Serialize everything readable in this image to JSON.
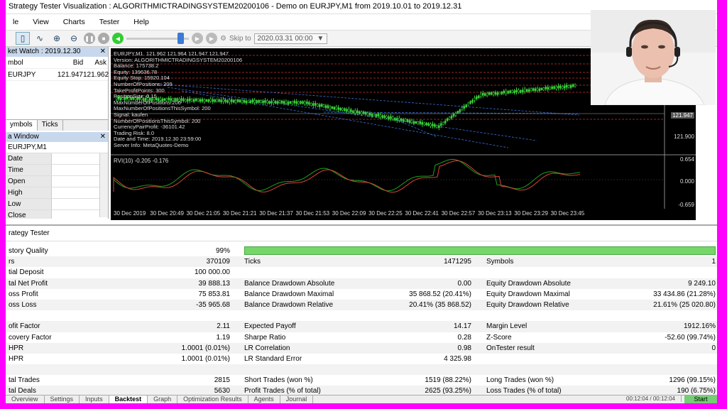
{
  "window": {
    "title": "Strategy Tester Visualization : ALGORITHMICTRADINGSYSTEM20200106 - Demo on EURJPY,M1 from 2019.10.01 to 2019.12.31"
  },
  "menu": [
    "le",
    "View",
    "Charts",
    "Tester",
    "Help"
  ],
  "toolbar": {
    "skip_label": "Skip to",
    "skip_date": "2020.03.31 00:00"
  },
  "market_watch": {
    "title": "ket Watch : 2019.12.30",
    "headers": [
      "mbol",
      "Bid",
      "Ask"
    ],
    "rows": [
      {
        "symbol": "EURJPY",
        "bid": "121.947",
        "ask": "121.962"
      }
    ],
    "tabs": [
      "ymbols",
      "Ticks"
    ]
  },
  "data_window": {
    "title": "a Window",
    "symbol": "EURJPY,M1",
    "rows": [
      "Date",
      "Time",
      "Open",
      "High",
      "Low",
      "Close"
    ]
  },
  "chart": {
    "info_lines": [
      "EURJPY,M1  121.962 121.964 121.947 121.947",
      "Version: ALGORITHMICTRADINGSYSTEM20200106",
      "Balance: 175738.2",
      "Equity: 139636.78",
      "Equity Stop: 15920.104",
      "NumberOfPositions: 209",
      "TakeProfitPoints: 300",
      "PositionSize: 0.15",
      "MaxNumberOfPositions:200",
      "MaxNumberOfPositionsThisSymbol: 200",
      "Signal: kaufen",
      "NumberOfPositionsThisSymbol: 200",
      "CurrencyPairProfit: -36101.42",
      "Trading Risk: 8.0",
      "Date and Time: 2019.12.30 23:59:00",
      "Server Info: MetaQuotes-Demo"
    ],
    "price_axis": [
      "121.947",
      "121.900"
    ],
    "rvi_label": "RVI(10) -0.205 -0.176",
    "rvi_axis": [
      "0.654",
      "0.000",
      "-0.659"
    ],
    "x_labels": [
      "30 Dec 2019",
      "30 Dec 20:49",
      "30 Dec 21:05",
      "30 Dec 21:21",
      "30 Dec 21:37",
      "30 Dec 21:53",
      "30 Dec 22:09",
      "30 Dec 22:25",
      "30 Dec 22:41",
      "30 Dec 22:57",
      "30 Dec 23:13",
      "30 Dec 23:29",
      "30 Dec 23:45"
    ]
  },
  "tester": {
    "title": "rategy Tester",
    "rows": [
      {
        "a": [
          "story Quality",
          "99%"
        ],
        "b": [
          "",
          ""
        ],
        "c": [
          "",
          ""
        ],
        "bar": true
      },
      {
        "a": [
          "rs",
          "370109"
        ],
        "b": [
          "Ticks",
          "1471295"
        ],
        "c": [
          "Symbols",
          "1"
        ]
      },
      {
        "a": [
          "tial Deposit",
          "100 000.00"
        ],
        "b": [
          "",
          ""
        ],
        "c": [
          "",
          ""
        ]
      },
      {
        "a": [
          "tal Net Profit",
          "39 888.13"
        ],
        "b": [
          "Balance Drawdown Absolute",
          "0.00"
        ],
        "c": [
          "Equity Drawdown Absolute",
          "9 249.10"
        ]
      },
      {
        "a": [
          "oss Profit",
          "75 853.81"
        ],
        "b": [
          "Balance Drawdown Maximal",
          "35 868.52 (20.41%)"
        ],
        "c": [
          "Equity Drawdown Maximal",
          "33 434.86 (21.28%)"
        ]
      },
      {
        "a": [
          "oss Loss",
          "-35 965.68"
        ],
        "b": [
          "Balance Drawdown Relative",
          "20.41% (35 868.52)"
        ],
        "c": [
          "Equity Drawdown Relative",
          "21.61% (25 020.80)"
        ]
      },
      {
        "a": [
          "",
          ""
        ],
        "b": [
          "",
          ""
        ],
        "c": [
          "",
          ""
        ]
      },
      {
        "a": [
          "ofit Factor",
          "2.11"
        ],
        "b": [
          "Expected Payoff",
          "14.17"
        ],
        "c": [
          "Margin Level",
          "1912.16%"
        ]
      },
      {
        "a": [
          "covery Factor",
          "1.19"
        ],
        "b": [
          "Sharpe Ratio",
          "0.28"
        ],
        "c": [
          "Z-Score",
          "-52.60 (99.74%)"
        ]
      },
      {
        "a": [
          "HPR",
          "1.0001 (0.01%)"
        ],
        "b": [
          "LR Correlation",
          "0.98"
        ],
        "c": [
          "OnTester result",
          "0"
        ]
      },
      {
        "a": [
          "HPR",
          "1.0001 (0.01%)"
        ],
        "b": [
          "LR Standard Error",
          "4 325.98"
        ],
        "c": [
          "",
          ""
        ]
      },
      {
        "a": [
          "",
          ""
        ],
        "b": [
          "",
          ""
        ],
        "c": [
          "",
          ""
        ]
      },
      {
        "a": [
          "tal Trades",
          "2815"
        ],
        "b": [
          "Short Trades (won %)",
          "1519 (88.22%)"
        ],
        "c": [
          "Long Trades (won %)",
          "1296 (99.15%)"
        ]
      },
      {
        "a": [
          "tal Deals",
          "5630"
        ],
        "b": [
          "Profit Trades (% of total)",
          "2625 (93.25%)"
        ],
        "c": [
          "Loss Trades (% of total)",
          "190 (6.75%)"
        ]
      }
    ],
    "tabs": [
      "Overview",
      "Settings",
      "Inputs",
      "Backtest",
      "Graph",
      "Optimization Results",
      "Agents",
      "Journal"
    ],
    "active_tab": "Backtest",
    "status": "00:12:04 / 00:12:04",
    "start_label": "Start"
  }
}
